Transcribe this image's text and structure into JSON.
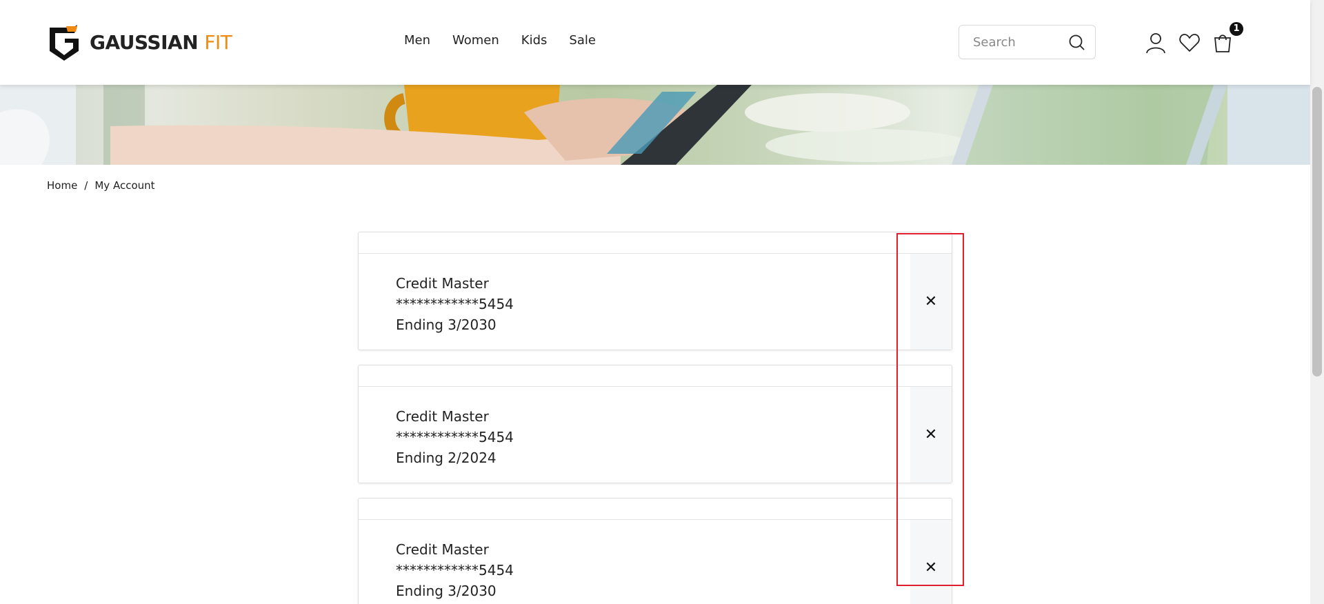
{
  "header": {
    "logo_primary": "GAUSSIAN",
    "logo_accent": "FIT",
    "nav": [
      "Men",
      "Women",
      "Kids",
      "Sale"
    ],
    "search_placeholder": "Search",
    "cart_count": "1",
    "icons": [
      "search-icon",
      "account-icon",
      "wishlist-icon",
      "cart-icon"
    ]
  },
  "breadcrumb": {
    "home": "Home",
    "separator": "/",
    "current": "My Account"
  },
  "cards": [
    {
      "brand": "Credit Master",
      "number": "************5454",
      "expiry": "Ending 3/2030",
      "remove": "✕"
    },
    {
      "brand": "Credit Master",
      "number": "************5454",
      "expiry": "Ending 2/2024",
      "remove": "✕"
    },
    {
      "brand": "Credit Master",
      "number": "************5454",
      "expiry": "Ending 3/2030",
      "remove": "✕"
    }
  ],
  "colors": {
    "accent": "#f08a12",
    "highlight": "#e01e2e",
    "badge": "#111111"
  }
}
